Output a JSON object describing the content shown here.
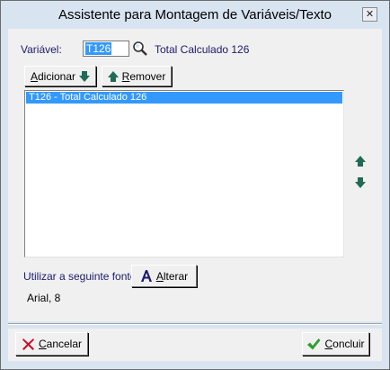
{
  "window": {
    "title": "Assistente para Montagem de Variáveis/Texto",
    "close_glyph": "✕"
  },
  "variavel": {
    "label": "Variável:",
    "value": "T126",
    "description": "Total Calculado 126"
  },
  "buttons": {
    "adicionar": {
      "label_u": "A",
      "label_rest": "dicionar"
    },
    "remover": {
      "label_u": "R",
      "label_rest": "emover"
    },
    "alterar": {
      "label_u": "A",
      "label_rest": "lterar"
    },
    "cancelar": {
      "label_u": "C",
      "label_rest": "ancelar"
    },
    "concluir": {
      "label_u": "C",
      "label_rest": "oncluir"
    }
  },
  "list": {
    "items": [
      {
        "label": "T126 - Total Calculado 126",
        "selected": true
      }
    ]
  },
  "fonte": {
    "label": "Utilizar a seguinte fonte:",
    "value": "Arial, 8"
  },
  "icons": {
    "search": "magnifier-icon",
    "down": "arrow-down-icon",
    "up": "arrow-up-icon",
    "font": "font-a-icon",
    "cancel": "x-icon",
    "ok": "checkmark-icon"
  },
  "colors": {
    "accent_selection": "#3399ff",
    "link_text": "#1a1a6e",
    "arrow_green": "#1f6b55"
  }
}
